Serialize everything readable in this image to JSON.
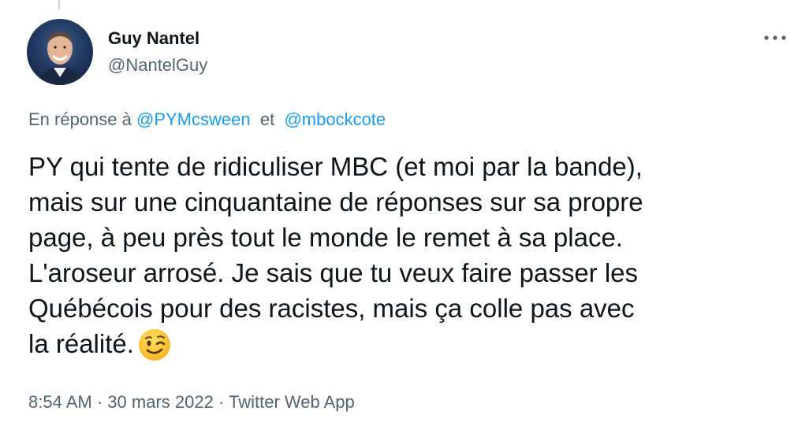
{
  "tweet": {
    "author": {
      "display_name": "Guy Nantel",
      "handle": "@NantelGuy",
      "avatar_icon": "profile-photo"
    },
    "more_icon": "more-options-icon",
    "reply": {
      "prefix": "En réponse à",
      "mention_1": "@PYMcsween",
      "joiner": "et",
      "mention_2": "@mbockcote"
    },
    "body_lines": [
      "PY qui tente de ridiculiser MBC (et moi par la bande),",
      "mais sur une cinquantaine de réponses sur sa propre",
      "page, à peu près tout le monde le remet à sa place.",
      "L'aroseur arrosé. Je sais que tu veux faire passer les",
      "Québécois pour des racistes, mais ça colle pas avec",
      "la réalité."
    ],
    "emoji_icon": "winking-face-icon",
    "meta": {
      "time": "8:54 AM",
      "separator": "·",
      "date": "30 mars 2022",
      "source": "Twitter Web App"
    },
    "colors": {
      "link": "#1d9bf0",
      "secondary_text": "#536471",
      "primary_text": "#0f1419"
    }
  }
}
